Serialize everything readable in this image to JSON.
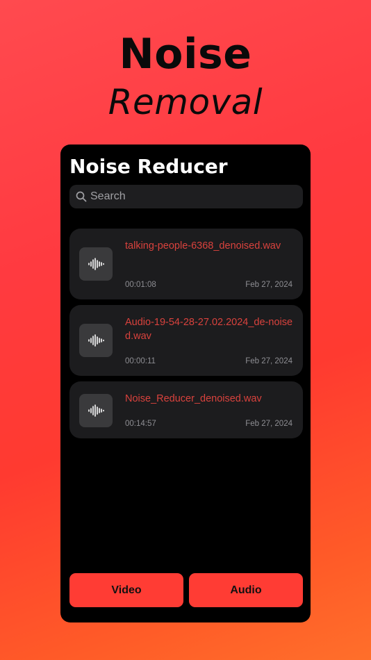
{
  "hero": {
    "title": "Noise",
    "subtitle": "Removal"
  },
  "screen": {
    "title": "Noise Reducer",
    "search": {
      "placeholder": "Search",
      "value": ""
    },
    "files": [
      {
        "name": "talking-people-6368_denoised.wav",
        "duration": "00:01:08",
        "date": "Feb 27, 2024"
      },
      {
        "name": "Audio-19-54-28-27.02.2024_de-noised.wav",
        "duration": "00:00:11",
        "date": "Feb 27, 2024"
      },
      {
        "name": "Noise_Reducer_denoised.wav",
        "duration": "00:14:57",
        "date": "Feb 27, 2024"
      }
    ],
    "buttons": {
      "video": "Video",
      "audio": "Audio"
    }
  },
  "colors": {
    "accent": "#ff3c34",
    "file_name": "#d9423d",
    "card_bg": "#1c1c1e",
    "screen_bg": "#000000"
  },
  "icons": {
    "search": "magnifying-glass-icon",
    "file": "audio-waveform-icon"
  }
}
